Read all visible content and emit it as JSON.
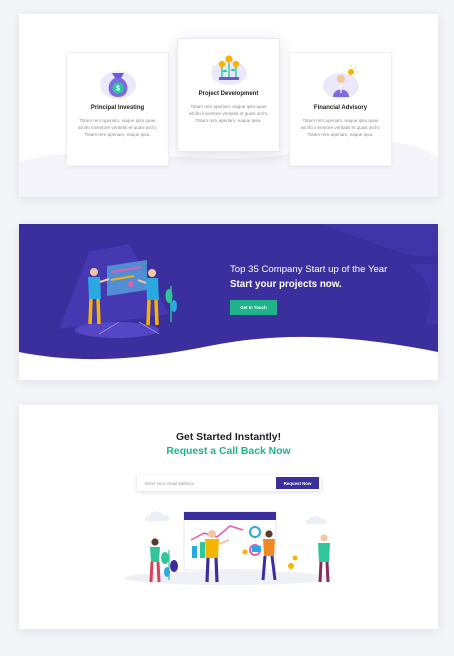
{
  "services": {
    "cards": [
      {
        "icon": "money-bag-icon",
        "title": "Principal Investing",
        "text": [
          "Totam rem aperiam, eaque ipsa quae",
          "ab illo inventore veritatis et quasi archi.",
          "Totam rem aperiam, eaque ipsa."
        ]
      },
      {
        "icon": "plant-growth-icon",
        "title": "Project Development",
        "text": [
          "Totam rem aperiam, eaque ipsa quae",
          "ab illo inventore veritatis et quasi archi.",
          "Totam rem aperiam, eaque ipsa."
        ]
      },
      {
        "icon": "advisor-idea-icon",
        "title": "Financial Advisory",
        "text": [
          "Totam rem aperiam, eaque ipsa quae",
          "ab illo inventore veritatis et quasi archi.",
          "Totam rem aperiam, eaque ipsa."
        ]
      }
    ]
  },
  "banner": {
    "subtitle": "Top 35 Company Start up of the Year",
    "title": "Start your projects now.",
    "button_label": "Get In Touch",
    "illustration": "team-dashboard-illustration",
    "colors": {
      "background": "#3b2f9e",
      "accent": "#1fb38a"
    }
  },
  "get_started": {
    "title": "Get Started Instantly!",
    "subtitle": "Request a Call Back Now",
    "email_placeholder": "Enter your email address",
    "button_label": "Request Now",
    "illustration": "team-growth-illustration"
  }
}
